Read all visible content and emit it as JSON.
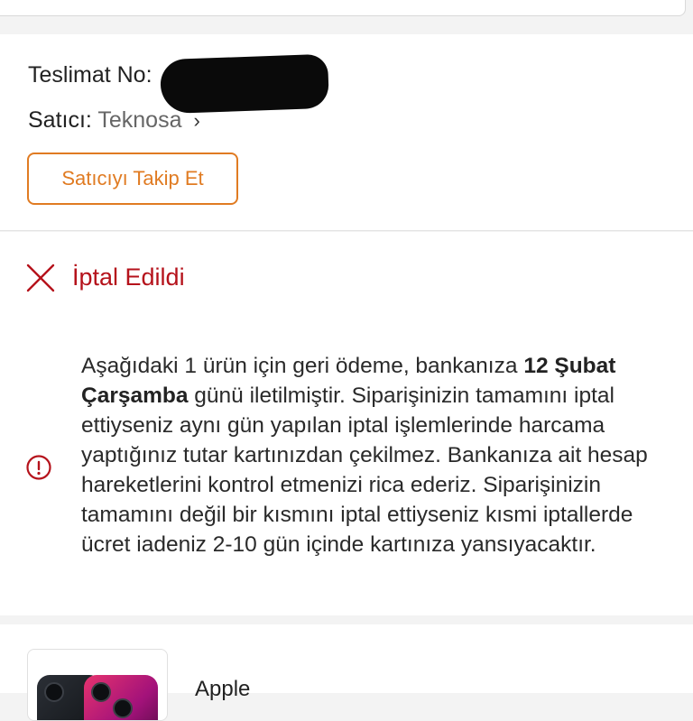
{
  "delivery": {
    "label": "Teslimat No:"
  },
  "seller": {
    "label": "Satıcı:",
    "name": "Teknosa",
    "chevron": "›",
    "follow_button": "Satıcıyı Takip Et"
  },
  "order_status": {
    "title": "İptal Edildi",
    "status_color": "#b5121b",
    "icon": "close-icon"
  },
  "refund_info": {
    "icon": "info-icon",
    "text_before_date": "Aşağıdaki 1 ürün için geri ödeme, bankanıza ",
    "date": "12 Şubat Çarşamba",
    "text_after_date": " günü iletilmiştir. Siparişinizin tamamını iptal ettiyseniz aynı gün yapılan iptal işlemlerinde harcama yaptığınız tutar kartınızdan çekilmez. Bankanıza ait hesap hareketlerini kontrol etmenizi rica ederiz. Siparişinizin tamamını değil bir kısmını iptal ettiyseniz kısmi iptallerde ücret iadeniz 2-10 gün içinde kartınıza yansıyacaktır."
  },
  "product": {
    "brand": "Apple"
  },
  "colors": {
    "accent": "#e07b22",
    "danger": "#b5121b",
    "background": "#f3f3f3"
  }
}
